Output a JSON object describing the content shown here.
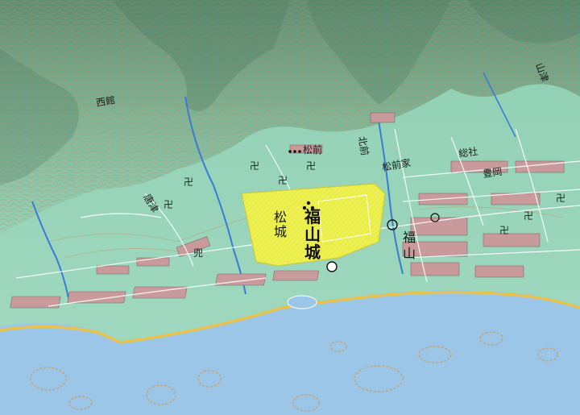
{
  "labels": {
    "fukuyama_castle": "福山城",
    "matsu_castle": "松城",
    "fukuyama": "福山",
    "karatsu": "唐津",
    "nishidate": "西館",
    "matsumae": "松前",
    "matsumae_house": "松前家",
    "toyooka": "豊岡",
    "yamatsu": "山津",
    "sosha": "総社",
    "kabuto": "兜",
    "kitsuta": "北前",
    "tera_mark": "卍"
  },
  "colors": {
    "sea": "#9cc6e8",
    "land": "#8fcfb3",
    "castle_area": "#f2f24a",
    "road": "#ffffff",
    "coast_road": "#e8c24a",
    "building": "#c99a9c",
    "river": "#3a7bd5"
  }
}
